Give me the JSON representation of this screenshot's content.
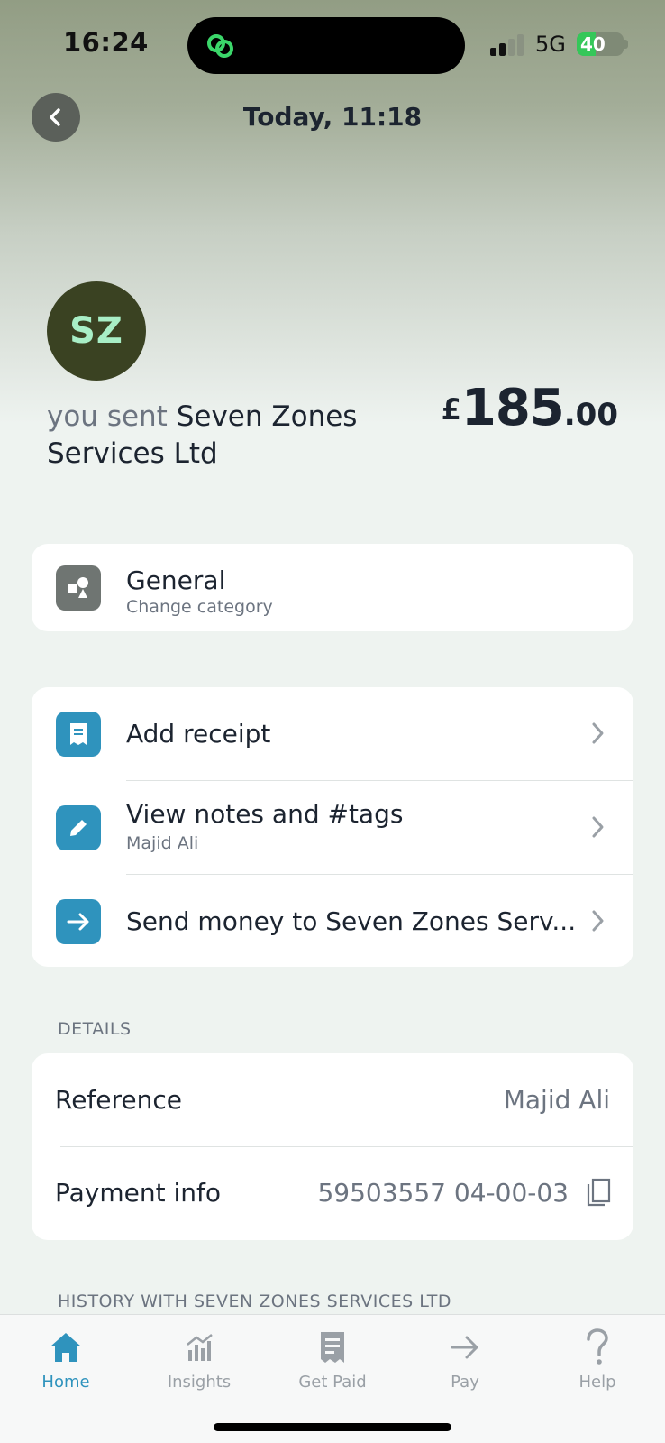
{
  "status_bar": {
    "time": "16:24",
    "network": "5G",
    "battery": "40"
  },
  "header": {
    "title": "Today, 11:18"
  },
  "transaction": {
    "initials": "SZ",
    "prefix": "you sent",
    "payee": "Seven Zones Services Ltd",
    "currency": "£",
    "amount_main": "185",
    "amount_decimal": ".00"
  },
  "category": {
    "title": "General",
    "subtitle": "Change category"
  },
  "actions": {
    "add_receipt": "Add receipt",
    "notes_title": "View notes and #tags",
    "notes_sub": "Majid Ali",
    "send_money": "Send money to Seven Zones Serv..."
  },
  "details": {
    "section_label": "DETAILS",
    "reference_label": "Reference",
    "reference_value": "Majid Ali",
    "payment_label": "Payment info",
    "payment_value": "59503557 04-00-03"
  },
  "history_label": "HISTORY WITH SEVEN ZONES SERVICES LTD",
  "tabs": [
    {
      "label": "Home",
      "icon": "home-icon",
      "active": true
    },
    {
      "label": "Insights",
      "icon": "insights-icon",
      "active": false
    },
    {
      "label": "Get Paid",
      "icon": "receipt-icon",
      "active": false
    },
    {
      "label": "Pay",
      "icon": "arrow-right-icon",
      "active": false
    },
    {
      "label": "Help",
      "icon": "help-icon",
      "active": false
    }
  ],
  "colors": {
    "accent": "#2f93bd",
    "avatar_bg": "#3a4222",
    "avatar_text": "#a8eec6"
  }
}
